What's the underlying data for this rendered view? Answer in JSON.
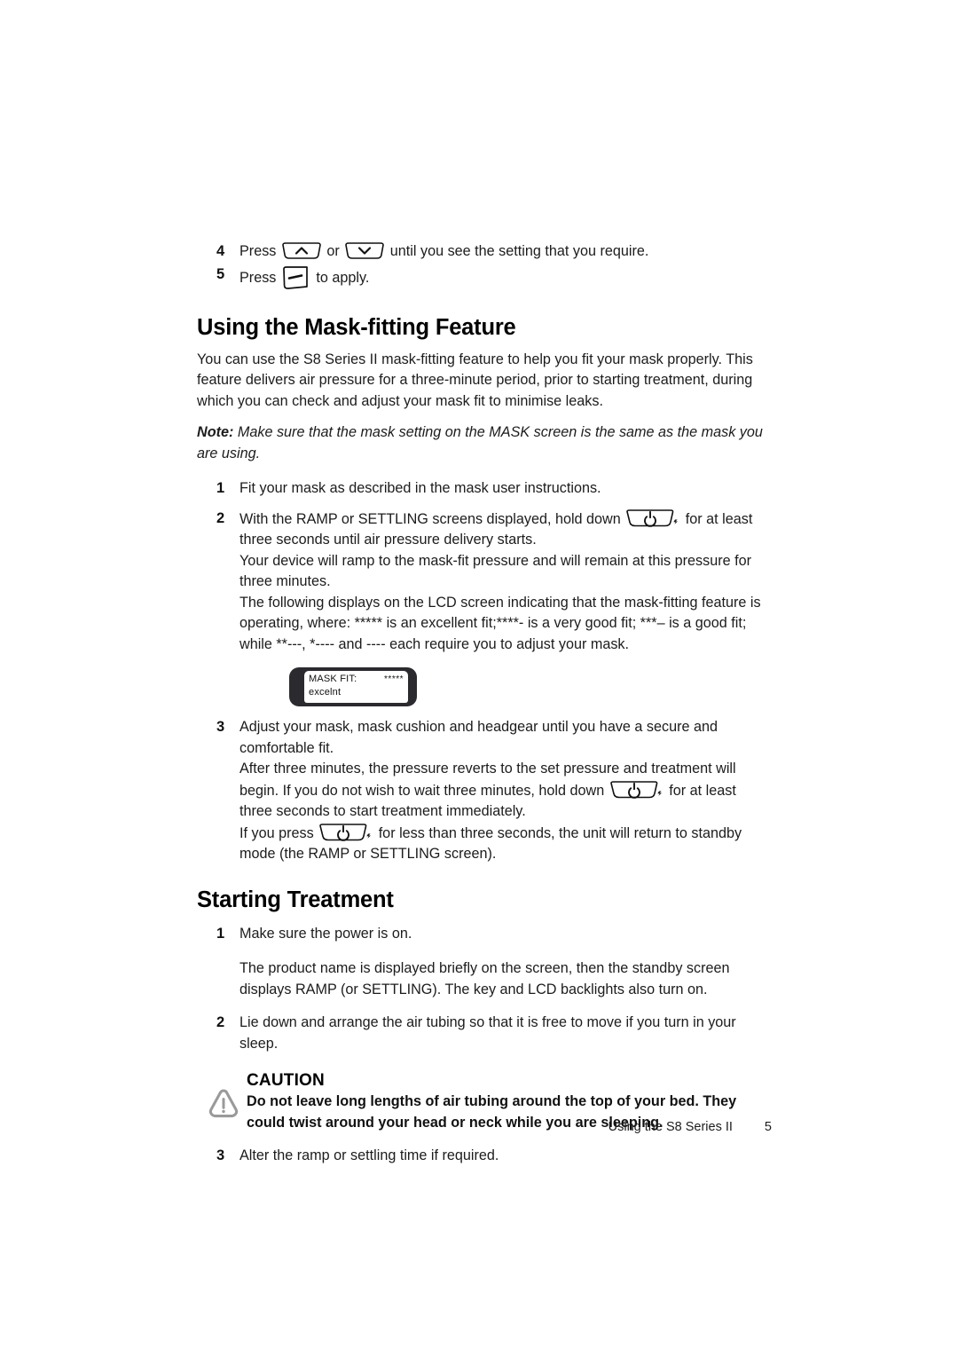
{
  "document": {
    "footer_label": "Using the S8 Series II",
    "page_number": "5"
  },
  "top_steps": [
    {
      "num": "4",
      "text_before": "Press",
      "key_up": "up-arrow-key",
      "text_mid": "or",
      "key_down": "down-arrow-key",
      "text_after": "until you see the setting that you require."
    },
    {
      "num": "5",
      "text_before": "Press",
      "key_apply": "apply-key",
      "text_after": "to apply."
    }
  ],
  "mask_fitting": {
    "heading": "Using the Mask-fitting Feature",
    "intro": "You can use the S8 Series II mask-fitting feature to help you fit your mask properly. This feature delivers air pressure for a three-minute period, prior to starting treatment, during which you can check and adjust your mask fit to minimise leaks.",
    "note_label": "Note:",
    "note_text": " Make sure that the mask setting on the MASK screen is the same as the mask you are using.",
    "steps": [
      {
        "num": "1",
        "lines": [
          "Fit your mask as described in the mask user instructions."
        ]
      },
      {
        "num": "2",
        "line1_a": "With the RAMP or SETTLING screens displayed, hold down",
        "line1_b": "for at least three seconds until air pressure delivery starts.",
        "line2": "Your device will ramp to the mask-fit pressure and will remain at this pressure for three minutes.",
        "line3": "The following displays on the LCD screen indicating that the mask-fitting feature is operating, where: ***** is an excellent fit;****- is a very good fit; ***– is a good fit; while **---, *---- and ---- each require you to adjust your mask."
      },
      {
        "num": "3",
        "line1": "Adjust your mask, mask cushion and headgear until you have a secure and comfortable fit.",
        "line2_a": "After three minutes, the pressure reverts to the set pressure and treatment will begin. If you do not wish to wait three minutes, hold down",
        "line2_b": "for at least three seconds to start treatment immediately.",
        "line3_a": "If you press",
        "line3_b": "for less than three seconds, the unit will return to standby mode (the RAMP or SETTLING screen)."
      }
    ],
    "lcd": {
      "label": "MASK FIT:",
      "stars": "*****",
      "value": "excelnt"
    }
  },
  "starting_treatment": {
    "heading": "Starting Treatment",
    "steps": [
      {
        "num": "1",
        "line1": "Make sure the power is on.",
        "line2": "The product name is displayed briefly on the screen, then the standby screen displays RAMP (or SETTLING). The key and LCD backlights also turn on."
      },
      {
        "num": "2",
        "line1": "Lie down and arrange the air tubing so that it is free to move if you turn in your sleep."
      },
      {
        "num": "3",
        "line1": "Alter the ramp or settling time if required."
      }
    ],
    "caution": {
      "title": "CAUTION",
      "text": "Do not leave long lengths of air tubing around the top of your bed. They could twist around your head or neck while you are sleeping."
    }
  },
  "colors": {
    "lcd_bezel": "#2b2b2f",
    "caution_icon": "#9a9a9a",
    "text": "#1c1c1c"
  }
}
